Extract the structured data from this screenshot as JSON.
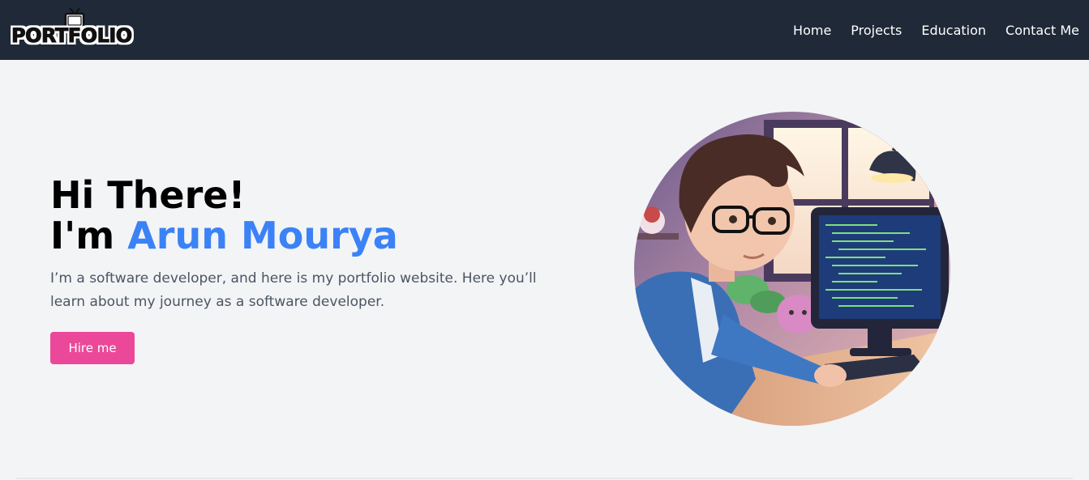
{
  "navbar": {
    "logo_text": "PORTFOLIO",
    "links": [
      "Home",
      "Projects",
      "Education",
      "Contact Me"
    ],
    "background": "#1f2937"
  },
  "hero": {
    "greeting": "Hi There!",
    "intro_prefix": "I'm ",
    "name": "Arun Mourya",
    "description": "I’m a software developer, and here is my portfolio website. Here you’ll learn about my journey as a software developer.",
    "button_label": "Hire me",
    "accent_color": "#3b82f6",
    "button_color": "#ec4899"
  },
  "icons": {
    "logo": "retro-tv-icon",
    "avatar": "developer-illustration"
  }
}
